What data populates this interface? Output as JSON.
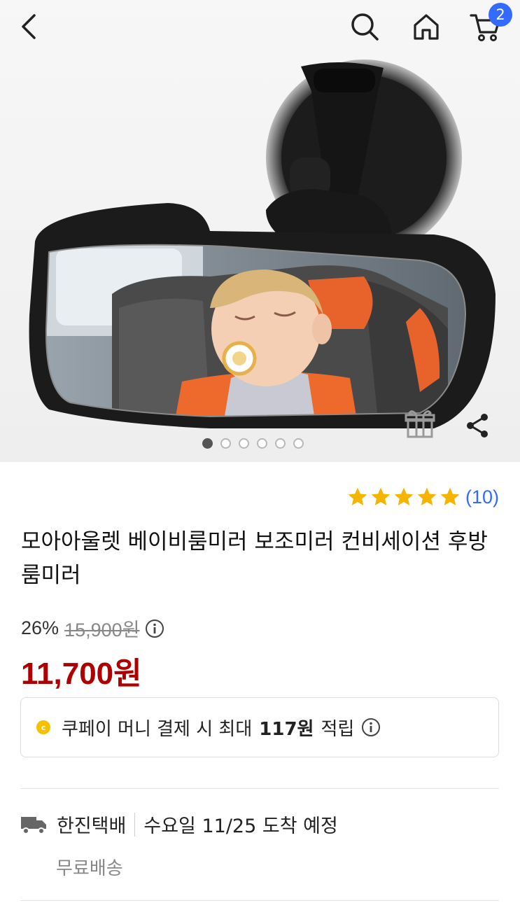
{
  "header": {
    "cart_count": "2"
  },
  "gallery": {
    "image_count": 6,
    "active_index": 0
  },
  "rating": {
    "stars": 5,
    "review_count_label": "(10)"
  },
  "product": {
    "title": "모아아울렛 베이비룸미러 보조미러 컨비세이션 후방룸미러"
  },
  "price": {
    "discount_rate": "26%",
    "original_price": "15,900원",
    "sale_price": "11,700원"
  },
  "coupay": {
    "coin_letter": "c",
    "text_before": "쿠페이 머니 결제 시 최대",
    "amount": "117원",
    "text_after": "적립"
  },
  "shipping": {
    "carrier": "한진택배",
    "arrival": "수요일 11/25 도착 예정",
    "fee": "무료배송"
  },
  "colors": {
    "accent_blue": "#346aff",
    "price_red": "#ae0000",
    "star_yellow": "#f5b400",
    "coin_yellow": "#f5c000"
  }
}
